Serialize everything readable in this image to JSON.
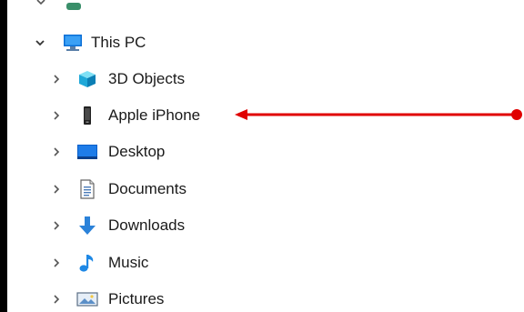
{
  "tree": {
    "root": {
      "label": "This PC",
      "icon": "monitor-icon",
      "expanded": true
    },
    "children": [
      {
        "label": "3D Objects",
        "icon": "cube-icon"
      },
      {
        "label": "Apple iPhone",
        "icon": "phone-icon"
      },
      {
        "label": "Desktop",
        "icon": "desktop-icon"
      },
      {
        "label": "Documents",
        "icon": "document-icon"
      },
      {
        "label": "Downloads",
        "icon": "download-icon"
      },
      {
        "label": "Music",
        "icon": "music-icon"
      },
      {
        "label": "Pictures",
        "icon": "pictures-icon"
      }
    ]
  },
  "annotation": {
    "color": "#e00000",
    "target": "Apple iPhone"
  }
}
